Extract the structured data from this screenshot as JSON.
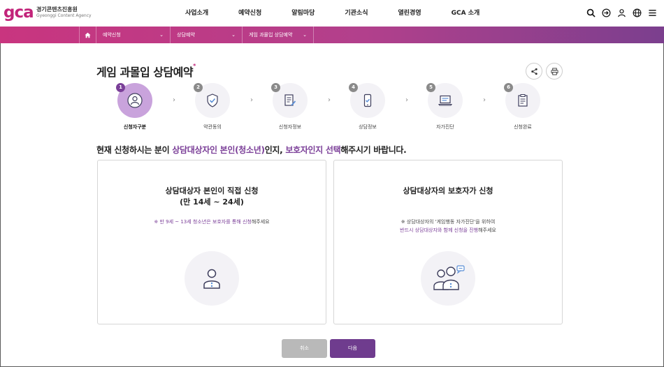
{
  "logo": {
    "mark": "gca",
    "org_kr": "경기콘텐츠진흥원",
    "org_en": "Gyeonggi Content Agency"
  },
  "gnb": [
    "사업소개",
    "예약신청",
    "알림마당",
    "기관소식",
    "열린경영",
    "GCA 소개"
  ],
  "util_icons": [
    "search-icon",
    "login-icon",
    "user-icon",
    "globe-icon",
    "menu-icon"
  ],
  "breadcrumb": {
    "items": [
      "예약신청",
      "상담예약",
      "게임 과몰입 상담예약"
    ]
  },
  "title": "게임 과몰입 상담예약",
  "title_mark": "*",
  "steps": [
    {
      "num": "1",
      "label": "신청자구분",
      "icon": "person-icon"
    },
    {
      "num": "2",
      "label": "약관동의",
      "icon": "shield-check-icon"
    },
    {
      "num": "3",
      "label": "신청자정보",
      "icon": "document-pen-icon"
    },
    {
      "num": "4",
      "label": "상담정보",
      "icon": "phone-check-icon"
    },
    {
      "num": "5",
      "label": "자가진단",
      "icon": "laptop-icon"
    },
    {
      "num": "6",
      "label": "신청완료",
      "icon": "clipboard-icon"
    }
  ],
  "headline": {
    "p1": "현재 신청하시는 분이 ",
    "hl1": "상담대상자인 본인(청소년)",
    "p2": "인지, ",
    "hl2": "보호자인지 선택",
    "p3": "해주시기 바랍니다."
  },
  "cards": {
    "self": {
      "title1": "상담대상자 본인이 직접 신청",
      "title2": "(만 14세 ~ 24세)",
      "note_p1": "※ 만 9세 ~ 13세 청소년은 보호자를 통해 신청",
      "note_p2": "해주세요"
    },
    "guardian": {
      "title1": "상담대상자의 보호자가 신청",
      "note1": "※ 상담대상자의 '게임행동 자가진단'을 위하여",
      "note2_p1": "반드시 상담대상자와 함께 신청을 진행",
      "note2_p2": "해주세요"
    }
  },
  "buttons": {
    "cancel": "취소",
    "next": "다음"
  },
  "colors": {
    "brand": "#c2247a",
    "purple": "#7b3f98",
    "active_step": "#c9a3dc"
  }
}
